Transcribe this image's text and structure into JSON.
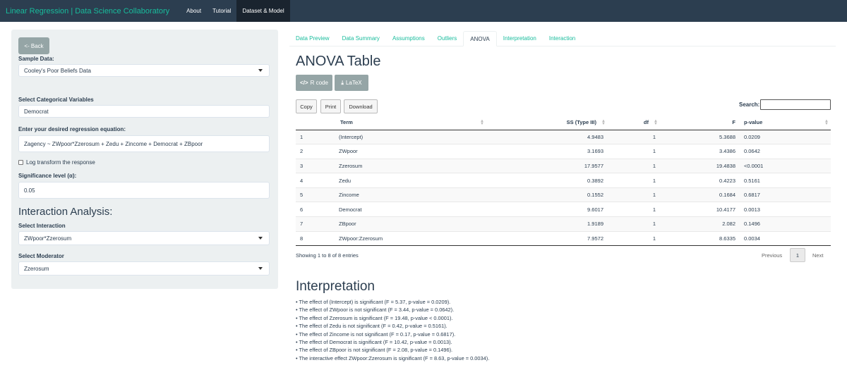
{
  "navbar": {
    "brand": "Linear Regression | Data Science Collaboratory",
    "items": [
      "About",
      "Tutorial",
      "Dataset & Model"
    ]
  },
  "sidebar": {
    "back_label": "<- Back",
    "sample_label": "Sample Data:",
    "sample_value": "Cooley's Poor Beliefs Data",
    "cat_label": "Select Categorical Variables",
    "cat_value": "Democrat",
    "eq_label": "Enter your desired regression equation:",
    "eq_value": "Zagency ~ ZWpoor*Zzerosum + Zedu + Zincome + Democrat + ZBpoor",
    "log_label": "Log transform the response",
    "sig_label": "Significance level (α):",
    "sig_value": "0.05",
    "interaction_heading": "Interaction Analysis:",
    "interaction_label": "Select Interaction",
    "interaction_value": "ZWpoor*Zzerosum",
    "moderator_label": "Select Moderator",
    "moderator_value": "Zzerosum"
  },
  "tabs": [
    "Data Preview",
    "Data Summary",
    "Assumptions",
    "Outliers",
    "ANOVA",
    "Interpretation",
    "Interaction"
  ],
  "main": {
    "anova_title": "ANOVA Table",
    "rcode_label": "R code",
    "latex_label": "LaTeX",
    "copy_label": "Copy",
    "print_label": "Print",
    "download_label": "Download",
    "search_label": "Search:",
    "columns": [
      "Term",
      "SS (Type III)",
      "df",
      "F",
      "p-value"
    ],
    "rows": [
      [
        "1",
        "(Intercept)",
        "4.9483",
        "1",
        "5.3688",
        "0.0209"
      ],
      [
        "2",
        "ZWpoor",
        "3.1693",
        "1",
        "3.4386",
        "0.0642"
      ],
      [
        "3",
        "Zzerosum",
        "17.9577",
        "1",
        "19.4838",
        "<0.0001"
      ],
      [
        "4",
        "Zedu",
        "0.3892",
        "1",
        "0.4223",
        "0.5161"
      ],
      [
        "5",
        "Zincome",
        "0.1552",
        "1",
        "0.1684",
        "0.6817"
      ],
      [
        "6",
        "Democrat",
        "9.6017",
        "1",
        "10.4177",
        "0.0013"
      ],
      [
        "7",
        "ZBpoor",
        "1.9189",
        "1",
        "2.082",
        "0.1496"
      ],
      [
        "8",
        "ZWpoor:Zzerosum",
        "7.9572",
        "1",
        "8.6335",
        "0.0034"
      ]
    ],
    "showing": "Showing 1 to 8 of 8 entries",
    "prev_label": "Previous",
    "page_label": "1",
    "next_label": "Next",
    "interp_title": "Interpretation",
    "interp_items": [
      "• The effect of (Intercept) is significant (F = 5.37, p-value = 0.0209).",
      "• The effect of ZWpoor is not significant (F = 3.44, p-value = 0.0642).",
      "• The effect of Zzerosum is significant (F = 19.48, p-value < 0.0001).",
      "• The effect of Zedu is not significant (F = 0.42, p-value = 0.5161).",
      "• The effect of Zincome is not significant (F = 0.17, p-value = 0.6817).",
      "• The effect of Democrat is significant (F = 10.42, p-value = 0.0013).",
      "• The effect of ZBpoor is not significant (F = 2.08, p-value = 0.1496).",
      "• The interactive effect ZWpoor:Zzerosum is significant (F = 8.63, p-value = 0.0034)."
    ]
  }
}
